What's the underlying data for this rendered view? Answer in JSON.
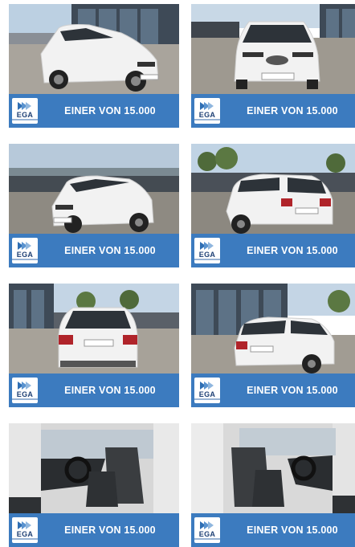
{
  "gallery": {
    "tiles": [
      {
        "banner_text": "EINER VON 15.000",
        "logo_text": "EGA"
      },
      {
        "banner_text": "EINER VON 15.000",
        "logo_text": "EGA"
      },
      {
        "banner_text": "EINER VON 15.000",
        "logo_text": "EGA"
      },
      {
        "banner_text": "EINER VON 15.000",
        "logo_text": "EGA"
      },
      {
        "banner_text": "EINER VON 15.000",
        "logo_text": "EGA"
      },
      {
        "banner_text": "EINER VON 15.000",
        "logo_text": "EGA"
      },
      {
        "banner_text": "EINER VON 15.000",
        "logo_text": "EGA"
      },
      {
        "banner_text": "EINER VON 15.000",
        "logo_text": "EGA"
      }
    ]
  },
  "colors": {
    "banner": "#3c7bbf",
    "banner_text": "#ffffff",
    "car_body": "#f2f2f2",
    "pavement": "#a9a49c"
  },
  "icons": [
    "ega-logo-icon"
  ]
}
